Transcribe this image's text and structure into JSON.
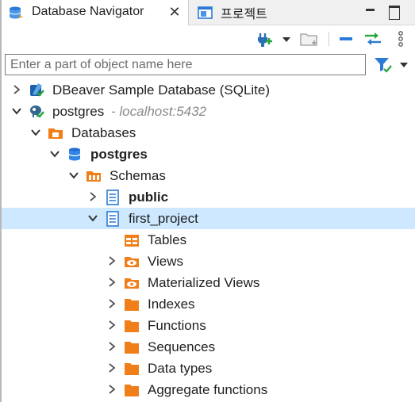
{
  "tabs": [
    {
      "label": "Database Navigator",
      "icon": "database-navigator-icon",
      "active": true
    },
    {
      "label": "프로젝트",
      "icon": "project-icon",
      "active": false
    }
  ],
  "filter": {
    "placeholder": "Enter a part of object name here",
    "value": ""
  },
  "colors": {
    "selection": "#cde8ff",
    "folder": "#f07f1a",
    "connect_green": "#27a53b",
    "db_blue": "#1f6fd1"
  },
  "tree": {
    "sample_db": {
      "label": "DBeaver Sample Database (SQLite)"
    },
    "postgres_conn": {
      "label": "postgres",
      "host": " - localhost:5432"
    },
    "databases": {
      "label": "Databases"
    },
    "postgres_db": {
      "label": "postgres"
    },
    "schemas": {
      "label": "Schemas"
    },
    "public": {
      "label": "public"
    },
    "first_project": {
      "label": "first_project"
    },
    "tables": {
      "label": "Tables"
    },
    "views": {
      "label": "Views"
    },
    "mat_views": {
      "label": "Materialized Views"
    },
    "indexes": {
      "label": "Indexes"
    },
    "functions": {
      "label": "Functions"
    },
    "sequences": {
      "label": "Sequences"
    },
    "data_types": {
      "label": "Data types"
    },
    "aggregate_functions": {
      "label": "Aggregate functions"
    }
  }
}
